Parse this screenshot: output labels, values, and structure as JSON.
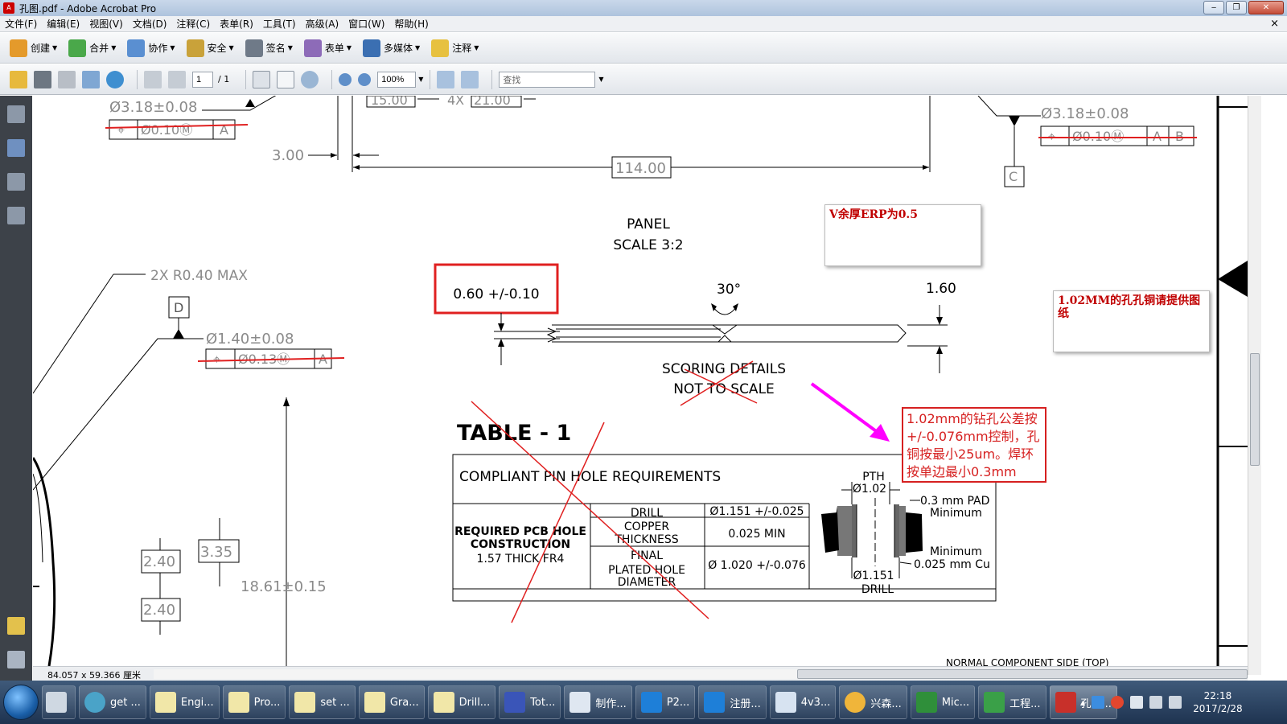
{
  "window": {
    "title": "孔图.pdf - Adobe Acrobat Pro",
    "controls": [
      "minimize",
      "restore",
      "close"
    ]
  },
  "menu": [
    "文件(F)",
    "编辑(E)",
    "视图(V)",
    "文档(D)",
    "注释(C)",
    "表单(R)",
    "工具(T)",
    "高级(A)",
    "窗口(W)",
    "帮助(H)"
  ],
  "doc_close": "×",
  "toolbar1": [
    {
      "label": "创建",
      "icon": "create-icon",
      "color": "#e49a2b"
    },
    {
      "label": "合并",
      "icon": "combine-icon",
      "color": "#4aa84a"
    },
    {
      "label": "协作",
      "icon": "collaborate-icon",
      "color": "#5a8fd1"
    },
    {
      "label": "安全",
      "icon": "lock-icon",
      "color": "#c9a23a"
    },
    {
      "label": "签名",
      "icon": "pen-icon",
      "color": "#6f7a88"
    },
    {
      "label": "表单",
      "icon": "form-icon",
      "color": "#8d6bb8"
    },
    {
      "label": "多媒体",
      "icon": "multimedia-icon",
      "color": "#3b6fb2"
    },
    {
      "label": "注释",
      "icon": "comment-icon",
      "color": "#e7c140"
    }
  ],
  "toolbar2": {
    "page_current": "1",
    "page_total": "/ 1",
    "zoom": "100%",
    "search_placeholder": "查找"
  },
  "drawing": {
    "top_left_dim": "Ø3.18±0.08",
    "top_left_fcf": [
      "⌖",
      "Ø0.10Ⓜ",
      "A"
    ],
    "top_dim_15": "15.00",
    "top_dim_4x": "4X",
    "top_dim_21": "21.00",
    "dim_3": "3.00",
    "dim_114": "114.00",
    "top_right_dim": "Ø3.18±0.08",
    "top_right_fcf": [
      "⌖",
      "Ø0.10Ⓜ",
      "A",
      "B"
    ],
    "datum_c": "C",
    "panel_title": "PANEL",
    "panel_scale": "SCALE 3:2",
    "radius_note": "2X R0.40 MAX",
    "datum_d": "D",
    "mid_dim": "Ø1.40±0.08",
    "mid_fcf": [
      "⌖",
      "Ø0.13Ⓜ",
      "A"
    ],
    "thickness_tol": "0.60 +/-0.10",
    "angle": "30°",
    "board_thickness": "1.60",
    "scoring_1": "SCORING DETAILS",
    "scoring_2": "NOT TO SCALE",
    "dim_240a": "2.40",
    "dim_335": "3.35",
    "dim_240b": "2.40",
    "dim_1861": "18.61±0.15",
    "table_title": "TABLE - 1",
    "table_header": "COMPLIANT PIN HOLE REQUIREMENTS",
    "table_left_1": "REQUIRED PCB HOLE",
    "table_left_2": "CONSTRUCTION",
    "table_left_3": "1.57 THICK FR4",
    "row1_label": "DRILL",
    "row1_value": "Ø1.151 +/-0.025",
    "row2_label_1": "COPPER",
    "row2_label_2": "THICKNESS",
    "row2_value": "0.025 MIN",
    "row3_label_1": "FINAL",
    "row3_label_2": "PLATED HOLE",
    "row3_label_3": "DIAMETER",
    "row3_value": "Ø  1.020 +/-0.076",
    "pth": "PTH",
    "pth_dia": "Ø1.02",
    "pad_1": "0.3 mm PAD",
    "pad_2": "Minimum",
    "cu_1": "Minimum",
    "cu_2": "0.025 mm Cu",
    "drill_dia": "Ø1.151",
    "drill": "DRILL",
    "bottom_text": "NORMAL COMPONENT SIDE (TOP)"
  },
  "notes": {
    "note1": "V余厚ERP为0.5",
    "note2": "1.02MM的孔孔铜请提供图纸",
    "note3": "1.02mm的钻孔公差按+/-0.076mm控制，孔铜按最小25um。焊环按单边最小0.3mm"
  },
  "status": {
    "page_size": "84.057 x 59.366 厘米"
  },
  "taskbar": {
    "items": [
      "get ...",
      "Engi...",
      "Pro...",
      "set ...",
      "Gra...",
      "Drill...",
      "Tot...",
      "制作...",
      "P2...",
      "注册...",
      "4v3...",
      "兴森...",
      "Mic...",
      "工程...",
      "孔图..."
    ],
    "time": "22:18",
    "date": "2017/2/28"
  },
  "colors": {
    "markup_red": "#e02020",
    "arrow_magenta": "#ff00ff",
    "drawing_gray": "#8a8a8a"
  }
}
